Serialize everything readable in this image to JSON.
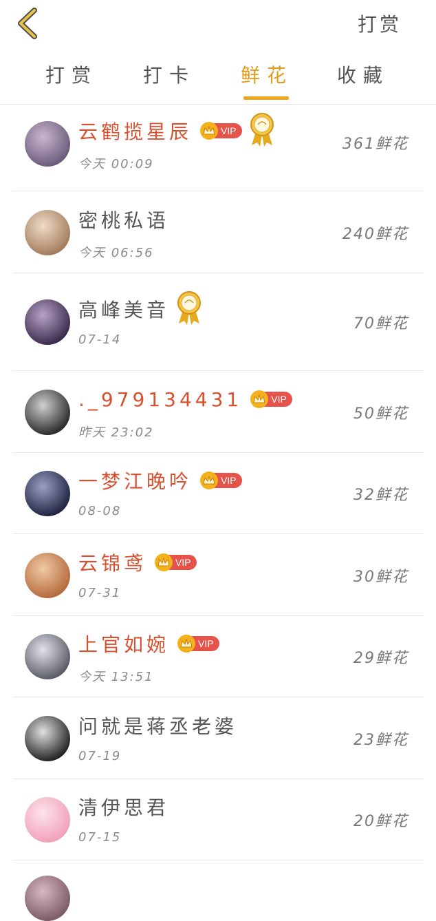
{
  "header": {
    "right_action": "打赏"
  },
  "tabs": [
    {
      "label": "打赏"
    },
    {
      "label": "打卡"
    },
    {
      "label": "鲜花"
    },
    {
      "label": "收藏"
    }
  ],
  "active_tab": "鲜花",
  "colors": {
    "accent": "#f0a51c",
    "vip_name": "#d9502f",
    "vip_tag": "#e5534b",
    "crown": "#f3b21b"
  },
  "vip_label": "VIP",
  "rows": [
    {
      "name": "云鹤揽星辰",
      "vip": true,
      "medal": true,
      "time": "今天 00:09",
      "amount": "361鲜花"
    },
    {
      "name": "密桃私语",
      "vip": false,
      "medal": false,
      "time": "今天 06:56",
      "amount": "240鲜花"
    },
    {
      "name": "高峰美音",
      "vip": false,
      "medal": true,
      "time": "07-14",
      "amount": "70鲜花"
    },
    {
      "name": "._979134431",
      "vip": true,
      "medal": false,
      "time": "昨天 23:02",
      "amount": "50鲜花"
    },
    {
      "name": "一梦江晚吟",
      "vip": true,
      "medal": false,
      "time": "08-08",
      "amount": "32鲜花"
    },
    {
      "name": "云锦鸢",
      "vip": true,
      "medal": false,
      "time": "07-31",
      "amount": "30鲜花"
    },
    {
      "name": "上官如婉",
      "vip": true,
      "medal": false,
      "time": "今天 13:51",
      "amount": "29鲜花"
    },
    {
      "name": "问就是蒋丞老婆",
      "vip": false,
      "medal": false,
      "time": "07-19",
      "amount": "23鲜花"
    },
    {
      "name": "清伊思君",
      "vip": false,
      "medal": false,
      "time": "07-15",
      "amount": "20鲜花"
    }
  ]
}
